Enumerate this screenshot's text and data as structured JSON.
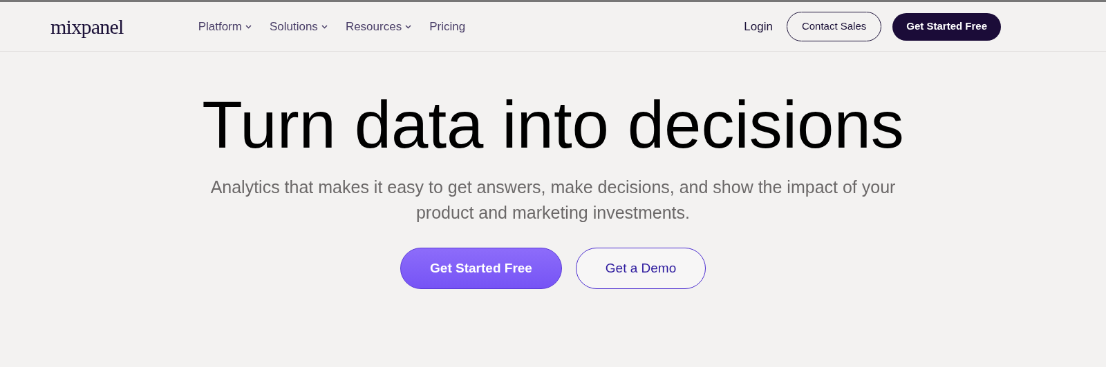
{
  "header": {
    "logo": "mixpanel",
    "nav": [
      {
        "label": "Platform",
        "has_menu": true
      },
      {
        "label": "Solutions",
        "has_menu": true
      },
      {
        "label": "Resources",
        "has_menu": true
      },
      {
        "label": "Pricing",
        "has_menu": false
      }
    ],
    "actions": [
      {
        "label": "Login",
        "kind": "link"
      },
      {
        "label": "Contact Sales",
        "kind": "outline"
      },
      {
        "label": "Get Started Free",
        "kind": "dark"
      }
    ]
  },
  "hero": {
    "title": "Turn data into decisions",
    "subtitle": "Analytics that makes it easy to get answers, make decisions, and show the impact of your product and marketing investments.",
    "buttons": [
      {
        "label": "Get Started Free",
        "kind": "primary"
      },
      {
        "label": "Get a Demo",
        "kind": "secondary"
      }
    ]
  }
}
